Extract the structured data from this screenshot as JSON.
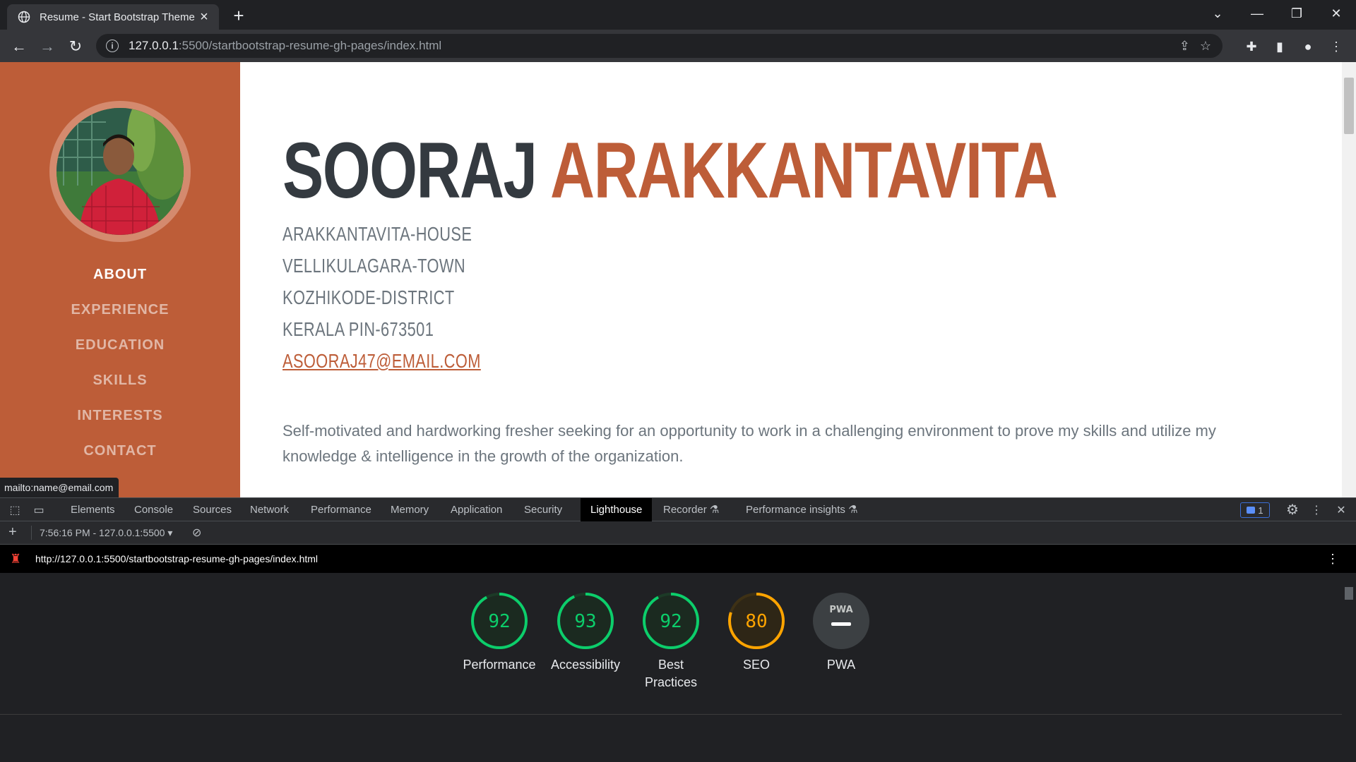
{
  "browser": {
    "tab_title": "Resume - Start Bootstrap Theme",
    "url_host": "127.0.0.1",
    "url_path": ":5500/startbootstrap-resume-gh-pages/index.html",
    "status_link": "mailto:name@email.com"
  },
  "sidebar": {
    "nav": [
      "ABOUT",
      "EXPERIENCE",
      "EDUCATION",
      "SKILLS",
      "INTERESTS",
      "CONTACT"
    ],
    "active": "ABOUT"
  },
  "resume": {
    "first_name": "SOORAJ",
    "last_name": "ARAKKANTAVITA",
    "address": [
      "ARAKKANTAVITA-HOUSE",
      "VELLIKULAGARA-TOWN",
      "KOZHIKODE-DISTRICT",
      "KERALA PIN-673501"
    ],
    "email": "ASOORAJ47@EMAIL.COM",
    "about": "Self-motivated and hardworking fresher seeking for an opportunity to work in a challenging environment to prove my skills and utilize my knowledge & intelligence in the growth of the organization."
  },
  "devtools": {
    "tabs": [
      "Elements",
      "Console",
      "Sources",
      "Network",
      "Performance",
      "Memory",
      "Application",
      "Security",
      "Lighthouse",
      "Recorder",
      "Performance insights"
    ],
    "active_tab": "Lighthouse",
    "issues_count": "1",
    "report_selector": "7:56:16 PM - 127.0.0.1:5500",
    "report_url": "http://127.0.0.1:5500/startbootstrap-resume-gh-pages/index.html",
    "scores": [
      {
        "label": "Performance",
        "value": "92",
        "fraction": 0.92,
        "color": "#0cce6b"
      },
      {
        "label": "Accessibility",
        "value": "93",
        "fraction": 0.93,
        "color": "#0cce6b"
      },
      {
        "label": "Best Practices",
        "value": "92",
        "fraction": 0.92,
        "color": "#0cce6b"
      },
      {
        "label": "SEO",
        "value": "80",
        "fraction": 0.8,
        "color": "#ffa400"
      },
      {
        "label": "PWA",
        "value": "PWA",
        "fraction": 0,
        "color": "#9aa0a6"
      }
    ]
  },
  "colors": {
    "accent": "#bd5d38",
    "heading": "#343a40"
  }
}
